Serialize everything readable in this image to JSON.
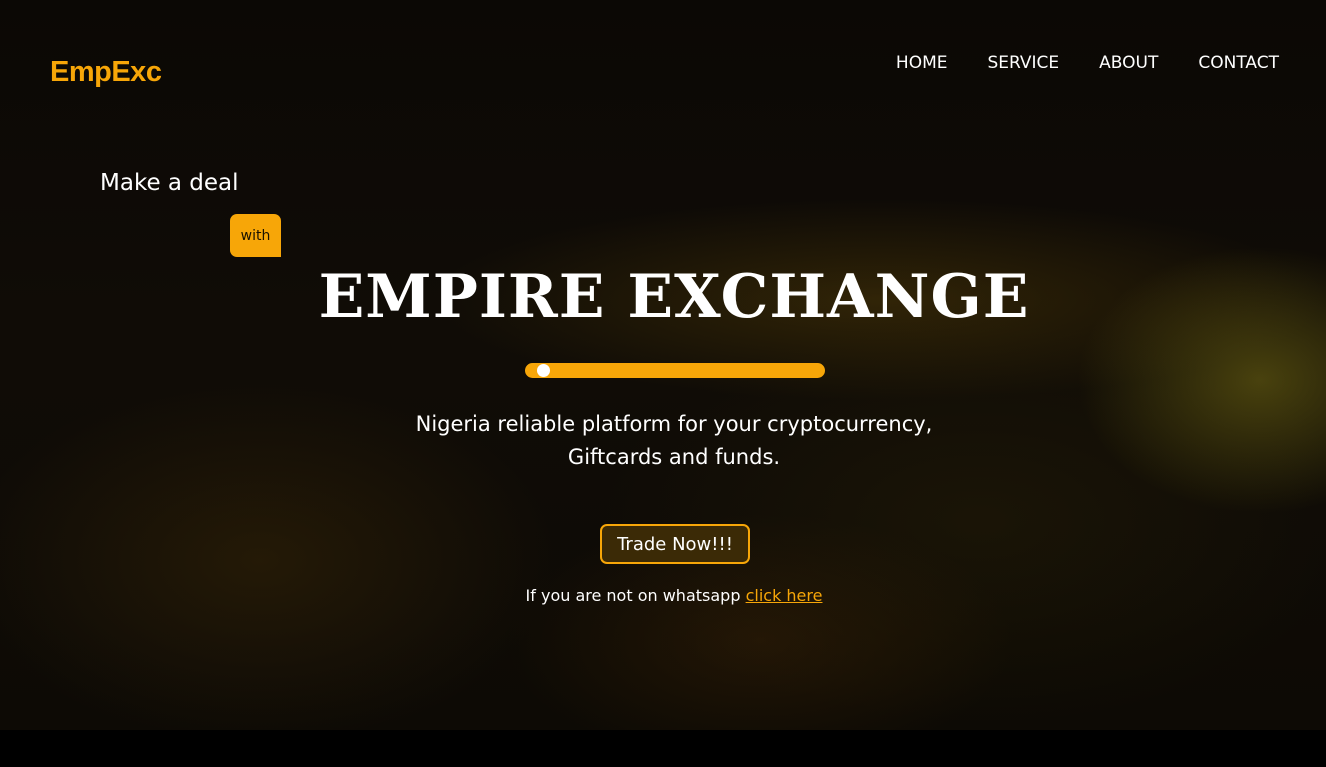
{
  "brand": {
    "logo_text": "EmpExc"
  },
  "nav": {
    "items": [
      "HOME",
      "SERVICE",
      "ABOUT",
      "CONTACT"
    ]
  },
  "hero": {
    "tagline": "Make a deal",
    "badge": "with",
    "headline": "EMPIRE EXCHANGE",
    "slider_level_percent": 4,
    "subtitle_line1": "Nigeria reliable platform for your cryptocurrency,",
    "subtitle_line2": "Giftcards and funds.",
    "cta_label": "Trade Now!!!",
    "note_text": "If you are not on whatsapp",
    "note_link": "click here"
  },
  "colors": {
    "accent": "#f7a608",
    "text": "#ffffff",
    "background": "#0d0a05"
  }
}
